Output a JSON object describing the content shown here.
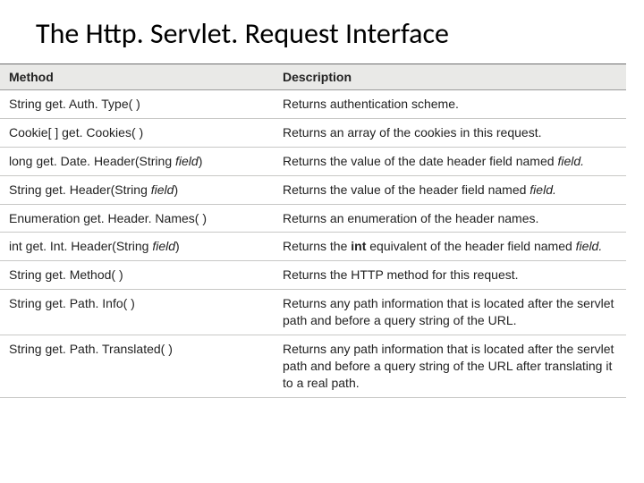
{
  "title": "The Http. Servlet. Request Interface",
  "table": {
    "headers": {
      "method": "Method",
      "description": "Description"
    },
    "rows": [
      {
        "m_pre": "String get. Auth. Type( )",
        "m_ital": "",
        "m_post": "",
        "d_pre": "Returns authentication scheme.",
        "d_bold": "",
        "d_mid": "",
        "d_ital": "",
        "d_post": ""
      },
      {
        "m_pre": "Cookie[ ] get. Cookies( )",
        "m_ital": "",
        "m_post": "",
        "d_pre": "Returns an array of the cookies in this request.",
        "d_bold": "",
        "d_mid": "",
        "d_ital": "",
        "d_post": ""
      },
      {
        "m_pre": "long get. Date. Header(String ",
        "m_ital": "field",
        "m_post": ")",
        "d_pre": "Returns the value of the date header field named ",
        "d_bold": "",
        "d_mid": "",
        "d_ital": "field.",
        "d_post": ""
      },
      {
        "m_pre": "String get. Header(String ",
        "m_ital": "field",
        "m_post": ")",
        "d_pre": "Returns the value of the header field named ",
        "d_bold": "",
        "d_mid": "",
        "d_ital": "field.",
        "d_post": ""
      },
      {
        "m_pre": "Enumeration get. Header. Names( )",
        "m_ital": "",
        "m_post": "",
        "d_pre": "Returns an enumeration of the header names.",
        "d_bold": "",
        "d_mid": "",
        "d_ital": "",
        "d_post": ""
      },
      {
        "m_pre": "int get. Int. Header(String ",
        "m_ital": "field",
        "m_post": ")",
        "d_pre": "Returns the ",
        "d_bold": "int",
        "d_mid": " equivalent of the header field named ",
        "d_ital": "field.",
        "d_post": ""
      },
      {
        "m_pre": "String get. Method( )",
        "m_ital": "",
        "m_post": "",
        "d_pre": "Returns the HTTP method for this request.",
        "d_bold": "",
        "d_mid": "",
        "d_ital": "",
        "d_post": ""
      },
      {
        "m_pre": "String get. Path. Info( )",
        "m_ital": "",
        "m_post": "",
        "d_pre": "Returns any path information that is located after the servlet path and before a query string of the URL.",
        "d_bold": "",
        "d_mid": "",
        "d_ital": "",
        "d_post": ""
      },
      {
        "m_pre": "String get. Path. Translated( )",
        "m_ital": "",
        "m_post": "",
        "d_pre": "Returns any path information that is located after the servlet path and before a query string of the URL after translating it to a real path.",
        "d_bold": "",
        "d_mid": "",
        "d_ital": "",
        "d_post": ""
      }
    ]
  }
}
